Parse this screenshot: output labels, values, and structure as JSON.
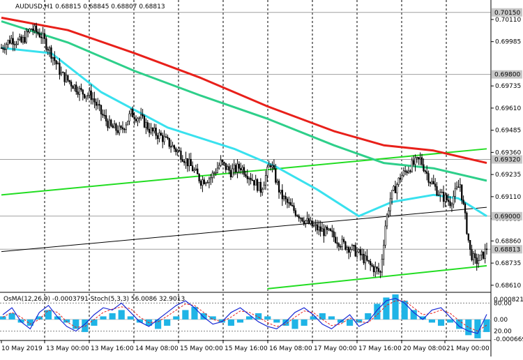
{
  "symbol_header": "AUDUSD,H1  0.68815 0.68845 0.68807 0.68813",
  "indicator_header": "OsMA(12,26,9) -0.0003791   Stoch(5,3,3) 56.0086 32.9013",
  "colors": {
    "candle": "#000000",
    "ma_red": "#e8201a",
    "ma_green": "#2ecf8a",
    "ma_cyan": "#39e1ee",
    "trendline": "#22dd22",
    "channel_black": "#000000",
    "osma_bar": "#1fb4e6",
    "stoch_main": "#1a2bd6",
    "stoch_signal": "#e8201a",
    "label_bg": "#c8c8c8"
  },
  "chart_data": [
    {
      "type": "candlestick",
      "title": "AUDUSD,H1",
      "price_axis_ticks": [
        "0.70110",
        "0.69985",
        "0.69735",
        "0.69610",
        "0.69485",
        "0.69360",
        "0.69235",
        "0.69110",
        "0.68985",
        "0.68860",
        "0.68735",
        "0.68610"
      ],
      "highlighted_levels": [
        {
          "label": "0.70150",
          "value": 0.7015
        },
        {
          "label": "0.69800",
          "value": 0.698
        },
        {
          "label": "0.69320",
          "value": 0.6932
        },
        {
          "label": "0.69000",
          "value": 0.69
        },
        {
          "label": "0.68813",
          "value": 0.68813
        }
      ],
      "ylim": [
        0.6857,
        0.7022
      ],
      "time_axis_labels": [
        "10 May 2019",
        "13 May 00:00",
        "13 May 16:00",
        "14 May 08:00",
        "15 May 00:00",
        "15 May 16:00",
        "16 May 08:00",
        "17 May 00:00",
        "17 May 16:00",
        "20 May 08:00",
        "21 May 00:00"
      ],
      "last": {
        "open": 0.68815,
        "high": 0.68845,
        "low": 0.68807,
        "close": 0.68813
      },
      "close_path": [
        [
          0,
          0.6995
        ],
        [
          6,
          0.7
        ],
        [
          12,
          0.6998
        ],
        [
          18,
          0.7006
        ],
        [
          24,
          0.7002
        ],
        [
          30,
          0.6992
        ],
        [
          36,
          0.698
        ],
        [
          42,
          0.6975
        ],
        [
          48,
          0.697
        ],
        [
          54,
          0.6968
        ],
        [
          60,
          0.6958
        ],
        [
          66,
          0.695
        ],
        [
          72,
          0.6948
        ],
        [
          78,
          0.6958
        ],
        [
          84,
          0.6955
        ],
        [
          90,
          0.6948
        ],
        [
          96,
          0.6945
        ],
        [
          102,
          0.694
        ],
        [
          108,
          0.6935
        ],
        [
          114,
          0.6928
        ],
        [
          120,
          0.692
        ],
        [
          126,
          0.6922
        ],
        [
          132,
          0.693
        ],
        [
          138,
          0.6925
        ],
        [
          144,
          0.6928
        ],
        [
          150,
          0.6922
        ],
        [
          156,
          0.6915
        ],
        [
          162,
          0.693
        ],
        [
          168,
          0.6912
        ],
        [
          174,
          0.6905
        ],
        [
          180,
          0.69
        ],
        [
          186,
          0.6895
        ],
        [
          192,
          0.6892
        ],
        [
          198,
          0.689
        ],
        [
          204,
          0.6885
        ],
        [
          210,
          0.6882
        ],
        [
          216,
          0.6878
        ],
        [
          222,
          0.6872
        ],
        [
          228,
          0.6868
        ],
        [
          231,
          0.6895
        ],
        [
          234,
          0.691
        ],
        [
          240,
          0.6922
        ],
        [
          246,
          0.6928
        ],
        [
          252,
          0.6932
        ],
        [
          258,
          0.692
        ],
        [
          264,
          0.6912
        ],
        [
          270,
          0.6908
        ],
        [
          276,
          0.6918
        ],
        [
          282,
          0.688
        ],
        [
          285,
          0.6874
        ],
        [
          288,
          0.6876
        ],
        [
          292,
          0.6881
        ]
      ],
      "series": [
        {
          "name": "",
          "color_key": "ma_red",
          "values": [
            [
              0,
              0.7012
            ],
            [
              40,
              0.7005
            ],
            [
              80,
              0.6992
            ],
            [
              120,
              0.6978
            ],
            [
              160,
              0.6962
            ],
            [
              200,
              0.6948
            ],
            [
              230,
              0.694
            ],
            [
              260,
              0.6937
            ],
            [
              292,
              0.693
            ]
          ]
        },
        {
          "name": "",
          "color_key": "ma_green",
          "values": [
            [
              0,
              0.701
            ],
            [
              40,
              0.6998
            ],
            [
              80,
              0.6982
            ],
            [
              120,
              0.6968
            ],
            [
              160,
              0.6955
            ],
            [
              200,
              0.694
            ],
            [
              230,
              0.693
            ],
            [
              260,
              0.6927
            ],
            [
              292,
              0.692
            ]
          ]
        },
        {
          "name": "",
          "color_key": "ma_cyan",
          "values": [
            [
              0,
              0.6995
            ],
            [
              30,
              0.6992
            ],
            [
              60,
              0.697
            ],
            [
              100,
              0.695
            ],
            [
              140,
              0.6938
            ],
            [
              165,
              0.6928
            ],
            [
              190,
              0.6915
            ],
            [
              215,
              0.69
            ],
            [
              235,
              0.6908
            ],
            [
              260,
              0.6912
            ],
            [
              275,
              0.691
            ],
            [
              292,
              0.69
            ]
          ]
        }
      ],
      "trendlines": [
        {
          "color_key": "trendline",
          "from": [
            0,
            0.6912
          ],
          "to": [
            292,
            0.6938
          ]
        },
        {
          "color_key": "trendline",
          "from": [
            160,
            0.6859
          ],
          "to": [
            292,
            0.6872
          ]
        },
        {
          "color_key": "channel_black",
          "from": [
            0,
            0.688
          ],
          "to": [
            292,
            0.6905
          ]
        }
      ]
    },
    {
      "type": "bar",
      "title": "OsMA(12,26,9) Stoch(5,3,3)",
      "axis_ticks": [
        "0.000821",
        "80.00",
        "0.00",
        "20.00",
        "-0.000669"
      ],
      "osma_range": [
        -0.000669,
        0.000821
      ],
      "stoch_levels": [
        80,
        20
      ],
      "osma_values": [
        0.0001,
        0.0002,
        -0.0001,
        -0.0002,
        0.0001,
        0.0003,
        0.0001,
        -0.0001,
        -0.0003,
        -0.0004,
        -0.0002,
        0.0001,
        0.0002,
        0.0003,
        0.0001,
        -0.0001,
        -0.0002,
        -0.0003,
        -0.0002,
        0.0001,
        0.0003,
        0.0004,
        0.0002,
        0.0001,
        -0.0001,
        -0.0002,
        -0.0001,
        0.0001,
        0.0002,
        0.0001,
        -0.0001,
        -0.0002,
        -0.0003,
        -0.0002,
        0.0001,
        0.0002,
        0.0001,
        -0.0001,
        -0.0002,
        -0.0001,
        0.0002,
        0.0005,
        0.0007,
        0.0008,
        0.0006,
        0.0003,
        0.0001,
        -0.0001,
        -0.0002,
        -0.0001,
        -0.0003,
        -0.0005,
        -0.0006,
        -0.0004
      ],
      "stoch_main": [
        55,
        70,
        40,
        25,
        60,
        75,
        50,
        30,
        20,
        35,
        55,
        70,
        65,
        80,
        60,
        40,
        30,
        45,
        60,
        75,
        85,
        70,
        50,
        35,
        40,
        60,
        70,
        55,
        40,
        30,
        25,
        40,
        60,
        70,
        55,
        35,
        25,
        40,
        55,
        30,
        40,
        65,
        85,
        90,
        80,
        60,
        45,
        65,
        70,
        50,
        30,
        20,
        15,
        56
      ],
      "stoch_signal": [
        50,
        60,
        50,
        35,
        45,
        65,
        60,
        40,
        28,
        30,
        45,
        60,
        67,
        72,
        68,
        50,
        38,
        40,
        52,
        65,
        78,
        75,
        60,
        45,
        40,
        50,
        63,
        60,
        50,
        38,
        30,
        35,
        50,
        63,
        60,
        45,
        32,
        35,
        48,
        40,
        38,
        55,
        75,
        85,
        85,
        70,
        55,
        58,
        65,
        58,
        42,
        28,
        20,
        33
      ]
    }
  ]
}
